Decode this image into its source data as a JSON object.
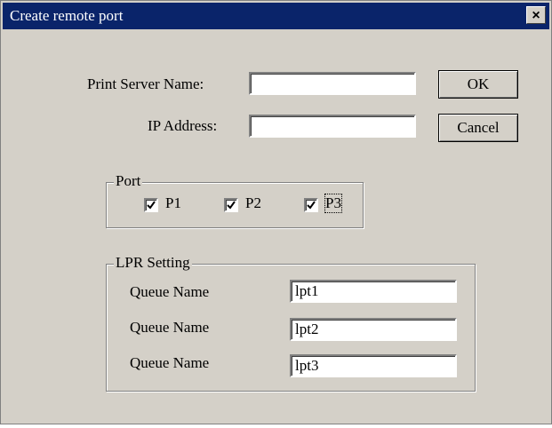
{
  "window": {
    "title": "Create remote port",
    "close_glyph": "×"
  },
  "form": {
    "print_server_label": "Print Server Name:",
    "print_server_value": "",
    "ip_label": "IP Address:",
    "ip_value": ""
  },
  "buttons": {
    "ok": "OK",
    "cancel": "Cancel"
  },
  "port_group": {
    "legend": "Port",
    "ports": [
      {
        "label": "P1",
        "checked": true
      },
      {
        "label": "P2",
        "checked": true
      },
      {
        "label": "P3",
        "checked": true
      }
    ]
  },
  "lpr_group": {
    "legend": "LPR Setting",
    "queues": [
      {
        "label": "Queue Name",
        "value": "lpt1"
      },
      {
        "label": "Queue Name",
        "value": "lpt2"
      },
      {
        "label": "Queue Name",
        "value": "lpt3"
      }
    ]
  }
}
